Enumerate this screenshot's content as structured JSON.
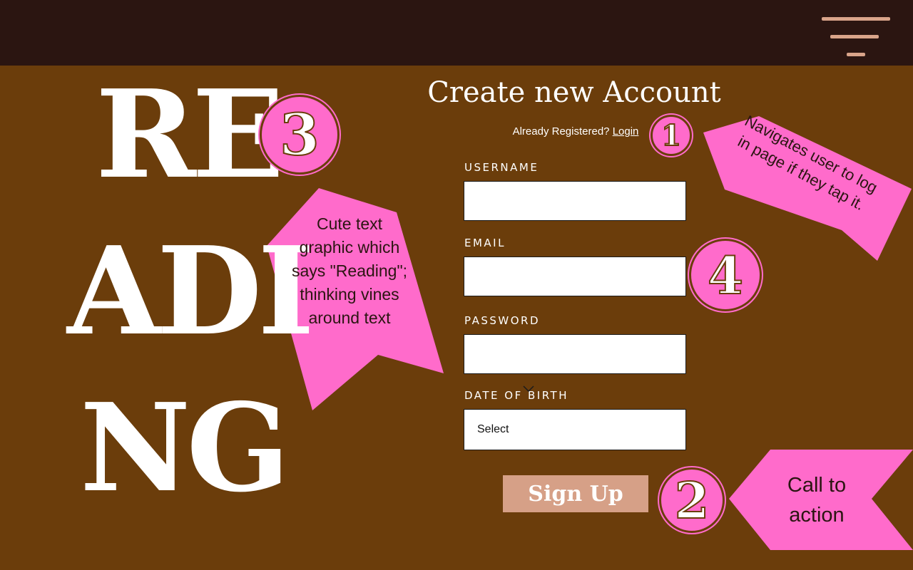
{
  "header": {
    "menu_icon": "hamburger-menu-icon"
  },
  "graphic": {
    "line1": "RE",
    "line2": "ADI",
    "line3": "NG"
  },
  "form": {
    "title": "Create new Account",
    "already_registered": "Already Registered?",
    "login_link": "Login",
    "username_label": "USERNAME",
    "username_value": "",
    "email_label": "EMAIL",
    "email_value": "",
    "password_label": "PASSWORD",
    "password_value": "",
    "dob_label": "DATE OF BIRTH",
    "dob_selected": "Select",
    "signup_label": "Sign Up"
  },
  "annotations": {
    "badge_1": "1",
    "badge_2": "2",
    "badge_3": "3",
    "badge_4": "4",
    "note_login": "Navigates user to log in page if they tap it.",
    "note_cta": "Call to action",
    "note_graphic": "Cute text graphic which says \"Reading\"; thinking vines around text",
    "callout_color": "#ff6bcb"
  },
  "colors": {
    "background": "#6b3d0b",
    "topbar": "#2b1511",
    "accent": "#d6a087",
    "text": "#ffffff"
  }
}
